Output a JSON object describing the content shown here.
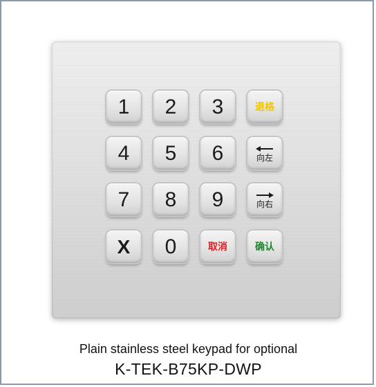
{
  "keys": {
    "k1": "1",
    "k2": "2",
    "k3": "3",
    "backspace": "退格",
    "k4": "4",
    "k5": "5",
    "k6": "6",
    "left": "向左",
    "k7": "7",
    "k8": "8",
    "k9": "9",
    "right": "向右",
    "x": "X",
    "k0": "0",
    "cancel": "取消",
    "confirm": "确认"
  },
  "colors": {
    "backspace": "#f2c500",
    "cancel": "#e02020",
    "confirm": "#1a8a2a"
  },
  "caption": {
    "line1": "Plain stainless steel keypad for optional",
    "line2": "K-TEK-B75KP-DWP"
  }
}
